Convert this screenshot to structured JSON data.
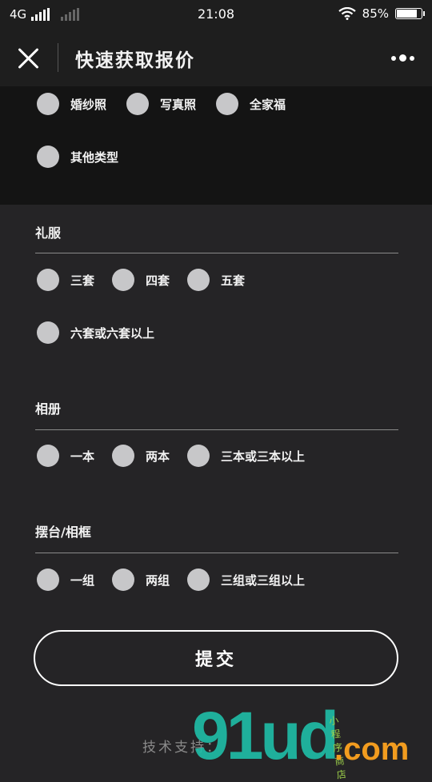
{
  "status_bar": {
    "network": "4G",
    "time": "21:08",
    "battery_percent": "85%",
    "battery_level": 0.85
  },
  "nav": {
    "title": "快速获取报价"
  },
  "type_options": [
    "婚纱照",
    "写真照",
    "全家福",
    "其他类型"
  ],
  "dress": {
    "title": "礼服",
    "options": [
      "三套",
      "四套",
      "五套",
      "六套或六套以上"
    ]
  },
  "album": {
    "title": "相册",
    "options": [
      "一本",
      "两本",
      "三本或三本以上"
    ]
  },
  "frame": {
    "title": "摆台/相框",
    "options": [
      "一组",
      "两组",
      "三组或三组以上"
    ]
  },
  "submit_label": "提交",
  "footer": "技术支持：",
  "watermark": {
    "main": "91ud",
    "suffix": ".com",
    "small": "小程序商店"
  },
  "colors": {
    "background": "#252426",
    "radio": "#c7c7c9",
    "watermark_teal": "#1fbfa8",
    "watermark_orange": "#f29c1f"
  }
}
